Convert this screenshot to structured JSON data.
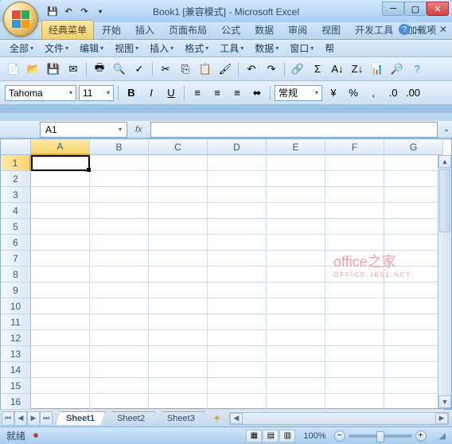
{
  "title": "Book1 [兼容模式] - Microsoft Excel",
  "office_button": "office-button",
  "qat": [
    "save-icon",
    "undo-icon",
    "redo-icon"
  ],
  "ribbon_tabs": [
    "经典菜单",
    "开始",
    "插入",
    "页面布局",
    "公式",
    "数据",
    "审阅",
    "视图",
    "开发工具",
    "加载项"
  ],
  "ribbon_active_index": 0,
  "menubar": [
    "全部",
    "文件",
    "编辑",
    "视图",
    "插入",
    "格式",
    "工具",
    "数据",
    "窗口",
    "帮"
  ],
  "toolbar1_icons": [
    "new",
    "open",
    "save",
    "mail",
    "print-preview",
    "print",
    "spell",
    "cut",
    "copy",
    "paste",
    "format-painter",
    "undo",
    "redo",
    "hyperlink",
    "sum",
    "sort-asc",
    "sort-desc",
    "chart",
    "percent",
    "help"
  ],
  "font": {
    "name": "Tahoma",
    "size": "11"
  },
  "format_style": "常规",
  "name_box": "A1",
  "fx_label": "fx",
  "columns": [
    "A",
    "B",
    "C",
    "D",
    "E",
    "F",
    "G"
  ],
  "rows": [
    "1",
    "2",
    "3",
    "4",
    "5",
    "6",
    "7",
    "8",
    "9",
    "10",
    "11",
    "12",
    "13",
    "14",
    "15",
    "16"
  ],
  "active_cell": {
    "row": 0,
    "col": 0
  },
  "watermark": "office之家",
  "watermark_sub": "OFFICE.JB51.NET",
  "sheets": [
    "Sheet1",
    "Sheet2",
    "Sheet3"
  ],
  "active_sheet_index": 0,
  "status": "就绪",
  "zoom": "100%"
}
